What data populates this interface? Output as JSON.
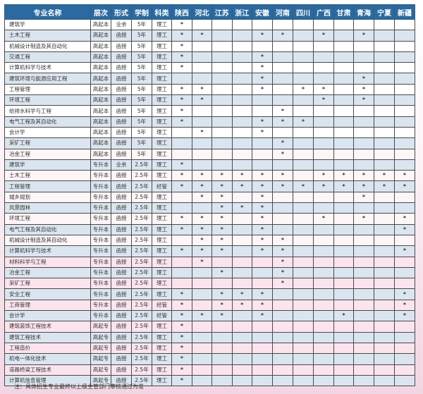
{
  "table": {
    "headers": [
      "专业名称",
      "层次",
      "形式",
      "学制",
      "科类",
      "陕西",
      "河北",
      "江苏",
      "浙江",
      "安徽",
      "河南",
      "四川",
      "广西",
      "甘肃",
      "青海",
      "宁夏",
      "新疆"
    ],
    "mark_symbol": "*",
    "rows": [
      {
        "name": "建筑学",
        "level": "高起本",
        "form": "业余",
        "years": "5年",
        "category": "理工",
        "provinces": [
          "陕西"
        ]
      },
      {
        "name": "土木工程",
        "level": "高起本",
        "form": "函授",
        "years": "5年",
        "category": "理工",
        "provinces": [
          "陕西",
          "河北",
          "安徽",
          "河南",
          "广西",
          "青海"
        ]
      },
      {
        "name": "机械设计制造及其自动化",
        "level": "高起本",
        "form": "函授",
        "years": "5年",
        "category": "理工",
        "provinces": [
          "陕西"
        ]
      },
      {
        "name": "交通工程",
        "level": "高起本",
        "form": "函授",
        "years": "5年",
        "category": "理工",
        "provinces": [
          "陕西",
          "安徽"
        ]
      },
      {
        "name": "计算机科学与技术",
        "level": "高起本",
        "form": "函授",
        "years": "5年",
        "category": "理工",
        "provinces": [
          "陕西",
          "安徽"
        ]
      },
      {
        "name": "建筑环境与能源应用工程",
        "level": "高起本",
        "form": "函授",
        "years": "5年",
        "category": "理工",
        "provinces": [
          "安徽",
          "青海"
        ]
      },
      {
        "name": "工程管理",
        "level": "高起本",
        "form": "函授",
        "years": "5年",
        "category": "理工",
        "provinces": [
          "陕西",
          "河北",
          "安徽",
          "四川",
          "广西",
          "青海"
        ]
      },
      {
        "name": "环境工程",
        "level": "高起本",
        "form": "函授",
        "years": "5年",
        "category": "理工",
        "provinces": [
          "陕西",
          "河北",
          "广西",
          "青海"
        ]
      },
      {
        "name": "给排水科学与工程",
        "level": "高起本",
        "form": "函授",
        "years": "5年",
        "category": "理工",
        "provinces": [
          "陕西",
          "河南"
        ]
      },
      {
        "name": "电气工程及其自动化",
        "level": "高起本",
        "form": "函授",
        "years": "5年",
        "category": "理工",
        "provinces": [
          "陕西",
          "安徽",
          "河南",
          "四川"
        ]
      },
      {
        "name": "会计学",
        "level": "高起本",
        "form": "函授",
        "years": "5年",
        "category": "理工",
        "provinces": [
          "河北",
          "安徽"
        ]
      },
      {
        "name": "采矿工程",
        "level": "高起本",
        "form": "函授",
        "years": "5年",
        "category": "理工",
        "provinces": [
          "河南"
        ]
      },
      {
        "name": "冶金工程",
        "level": "高起本",
        "form": "函授",
        "years": "5年",
        "category": "理工",
        "provinces": [
          "河南"
        ]
      },
      {
        "name": "建筑学",
        "level": "专升本",
        "form": "业余",
        "years": "2.5年",
        "category": "理工",
        "provinces": [
          "陕西"
        ]
      },
      {
        "name": "土木工程",
        "level": "专升本",
        "form": "函授",
        "years": "2.5年",
        "category": "理工",
        "provinces": [
          "陕西",
          "河北",
          "江苏",
          "浙江",
          "安徽",
          "河南",
          "广西",
          "甘肃",
          "青海",
          "宁夏",
          "新疆"
        ]
      },
      {
        "name": "工程管理",
        "level": "专升本",
        "form": "函授",
        "years": "2.5年",
        "category": "经管",
        "provinces": [
          "陕西",
          "河北",
          "江苏",
          "浙江",
          "安徽",
          "河南",
          "四川",
          "广西",
          "甘肃",
          "青海",
          "宁夏",
          "新疆"
        ]
      },
      {
        "name": "城乡规划",
        "level": "专升本",
        "form": "函授",
        "years": "2.5年",
        "category": "理工",
        "provinces": [
          "河北",
          "江苏",
          "安徽",
          "青海"
        ]
      },
      {
        "name": "风景园林",
        "level": "专升本",
        "form": "函授",
        "years": "2.5年",
        "category": "理工",
        "provinces": [
          "江苏",
          "浙江",
          "安徽"
        ]
      },
      {
        "name": "环境工程",
        "level": "专升本",
        "form": "函授",
        "years": "2.5年",
        "category": "理工",
        "provinces": [
          "陕西",
          "河北",
          "江苏",
          "安徽",
          "广西",
          "青海",
          "新疆"
        ]
      },
      {
        "name": "电气工程及其自动化",
        "level": "专升本",
        "form": "函授",
        "years": "2.5年",
        "category": "理工",
        "provinces": [
          "陕西",
          "河北",
          "江苏",
          "安徽",
          "新疆"
        ]
      },
      {
        "name": "机械设计制造及其自动化",
        "level": "专升本",
        "form": "函授",
        "years": "2.5年",
        "category": "理工",
        "provinces": [
          "河北",
          "江苏",
          "安徽",
          "河南"
        ]
      },
      {
        "name": "计算机科学与技术",
        "level": "专升本",
        "form": "函授",
        "years": "2.5年",
        "category": "理工",
        "provinces": [
          "陕西",
          "河北",
          "江苏",
          "安徽",
          "河南",
          "新疆"
        ]
      },
      {
        "name": "材料科学与工程",
        "level": "专升本",
        "form": "函授",
        "years": "2.5年",
        "category": "理工",
        "provinces": [
          "河北",
          "河南"
        ]
      },
      {
        "name": "冶金工程",
        "level": "专升本",
        "form": "函授",
        "years": "2.5年",
        "category": "理工",
        "provinces": [
          "江苏",
          "河南"
        ]
      },
      {
        "name": "采矿工程",
        "level": "专升本",
        "form": "函授",
        "years": "2.5年",
        "category": "理工",
        "provinces": [
          "河南"
        ]
      },
      {
        "name": "安全工程",
        "level": "专升本",
        "form": "函授",
        "years": "2.5年",
        "category": "理工",
        "provinces": [
          "陕西",
          "江苏",
          "浙江",
          "安徽",
          "新疆"
        ]
      },
      {
        "name": "工商管理",
        "level": "专升本",
        "form": "函授",
        "years": "2.5年",
        "category": "经管",
        "provinces": [
          "陕西",
          "江苏",
          "浙江",
          "安徽",
          "新疆"
        ]
      },
      {
        "name": "会计学",
        "level": "专升本",
        "form": "函授",
        "years": "2.5年",
        "category": "经管",
        "provinces": [
          "陕西",
          "河北",
          "江苏",
          "安徽",
          "甘肃",
          "新疆"
        ]
      },
      {
        "name": "建筑装饰工程技术",
        "level": "高起专",
        "form": "函授",
        "years": "2.5年",
        "category": "理工",
        "provinces": [
          "陕西"
        ]
      },
      {
        "name": "建筑工程技术",
        "level": "高起专",
        "form": "函授",
        "years": "2.5年",
        "category": "理工",
        "provinces": [
          "陕西"
        ]
      },
      {
        "name": "工程造价",
        "level": "高起专",
        "form": "函授",
        "years": "2.5年",
        "category": "理工",
        "provinces": [
          "陕西"
        ]
      },
      {
        "name": "机电一体化技术",
        "level": "高起专",
        "form": "函授",
        "years": "2.5年",
        "category": "理工",
        "provinces": [
          "陕西"
        ]
      },
      {
        "name": "道路桥梁工程技术",
        "level": "高起专",
        "form": "函授",
        "years": "2.5年",
        "category": "理工",
        "provinces": [
          "陕西"
        ]
      },
      {
        "name": "计算机信息管理",
        "level": "高起专",
        "form": "函授",
        "years": "2.5年",
        "category": "理工",
        "provinces": [
          "陕西"
        ]
      }
    ]
  },
  "note": "注：具体招生专业最终以上级主管部门审核通过为准",
  "colors": {
    "header_bg": "#2a6aa0",
    "header_text": "#ffffff",
    "row_alt_bg": "#dbe5ef"
  }
}
